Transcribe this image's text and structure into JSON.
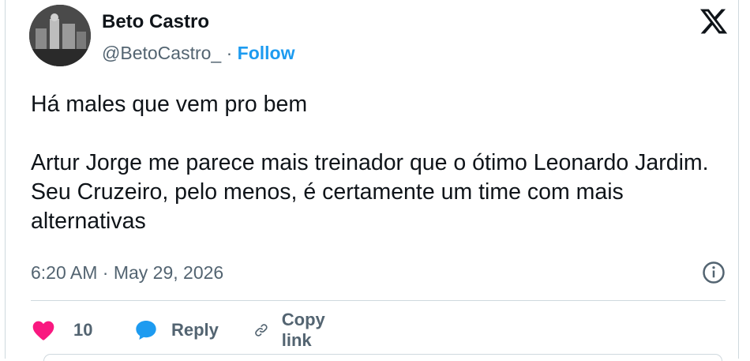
{
  "tweet": {
    "author_name": "Beto Castro",
    "author_handle": "@BetoCastro_",
    "separator": "·",
    "follow_label": "Follow",
    "text_lines": [
      "Há males que vem pro bem",
      "Artur Jorge me parece mais treinador que o ótimo Leonardo Jardim. Seu Cruzeiro, pelo menos, é certamente um time com mais alternativas"
    ],
    "timestamp": "6:20 AM · May 29, 2026"
  },
  "actions": {
    "like_count": "10",
    "reply_label": "Reply",
    "copy_link_label": "Copy link"
  },
  "icons": {
    "logo": "x-logo-icon",
    "info": "info-icon",
    "like": "heart-icon",
    "reply": "reply-bubble-icon",
    "copy": "link-icon"
  },
  "colors": {
    "follow": "#1d9bf0",
    "like": "#f91880",
    "reply": "#1d9bf0",
    "muted": "#536471",
    "text": "#0f1419"
  }
}
